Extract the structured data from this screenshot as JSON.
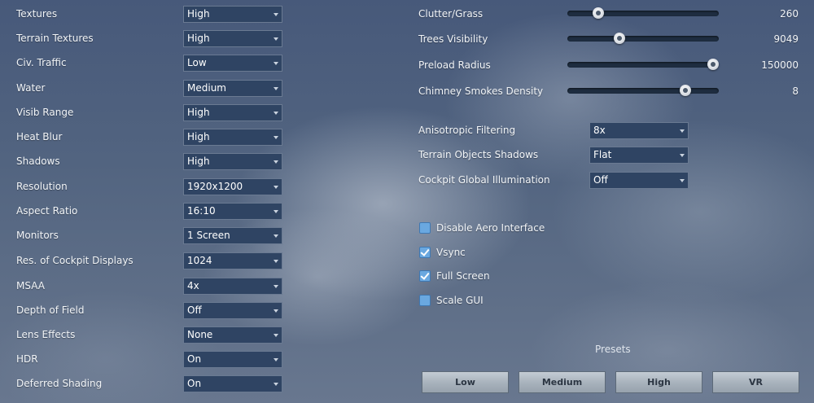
{
  "left_settings": [
    {
      "label": "Textures",
      "value": "High"
    },
    {
      "label": "Terrain Textures",
      "value": "High"
    },
    {
      "label": "Civ. Traffic",
      "value": "Low"
    },
    {
      "label": "Water",
      "value": "Medium"
    },
    {
      "label": "Visib Range",
      "value": "High"
    },
    {
      "label": "Heat Blur",
      "value": "High"
    },
    {
      "label": "Shadows",
      "value": "High"
    },
    {
      "label": "Resolution",
      "value": "1920x1200"
    },
    {
      "label": "Aspect Ratio",
      "value": "16:10"
    },
    {
      "label": "Monitors",
      "value": "1 Screen"
    },
    {
      "label": "Res. of Cockpit Displays",
      "value": "1024"
    },
    {
      "label": "MSAA",
      "value": "4x"
    },
    {
      "label": "Depth of Field",
      "value": "Off"
    },
    {
      "label": "Lens Effects",
      "value": "None"
    },
    {
      "label": "HDR",
      "value": "On"
    },
    {
      "label": "Deferred Shading",
      "value": "On"
    }
  ],
  "sliders": [
    {
      "label": "Clutter/Grass",
      "value": "260",
      "fraction": 0.18
    },
    {
      "label": "Trees Visibility",
      "value": "9049",
      "fraction": 0.33
    },
    {
      "label": "Preload Radius",
      "value": "150000",
      "fraction": 1.0
    },
    {
      "label": "Chimney Smokes Density",
      "value": "8",
      "fraction": 0.8
    }
  ],
  "right_dropdowns": [
    {
      "label": "Anisotropic Filtering",
      "value": "8x"
    },
    {
      "label": "Terrain Objects Shadows",
      "value": "Flat"
    },
    {
      "label": "Cockpit Global Illumination",
      "value": "Off"
    }
  ],
  "checkboxes": [
    {
      "label": "Disable Aero Interface",
      "checked": false
    },
    {
      "label": "Vsync",
      "checked": true
    },
    {
      "label": "Full Screen",
      "checked": true
    },
    {
      "label": "Scale GUI",
      "checked": false
    }
  ],
  "presets": {
    "title": "Presets",
    "buttons": [
      "Low",
      "Medium",
      "High",
      "VR"
    ]
  }
}
